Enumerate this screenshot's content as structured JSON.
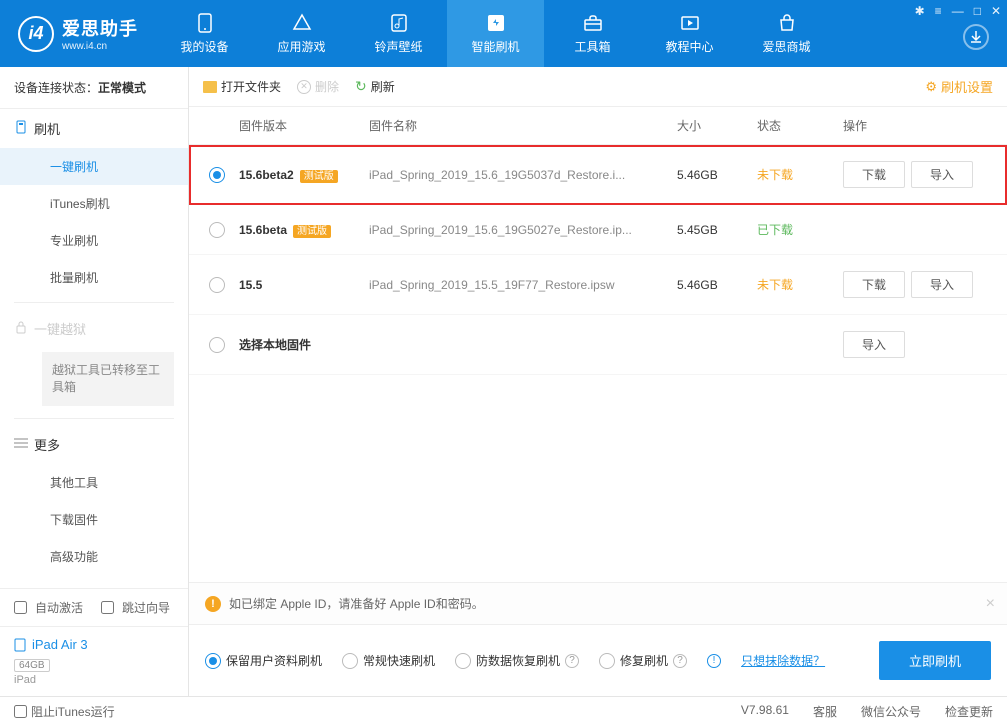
{
  "header": {
    "app_name": "爱思助手",
    "app_url": "www.i4.cn",
    "nav": [
      {
        "label": "我的设备",
        "icon": "device"
      },
      {
        "label": "应用游戏",
        "icon": "apps"
      },
      {
        "label": "铃声壁纸",
        "icon": "music"
      },
      {
        "label": "智能刷机",
        "icon": "flash"
      },
      {
        "label": "工具箱",
        "icon": "toolbox"
      },
      {
        "label": "教程中心",
        "icon": "tutorial"
      },
      {
        "label": "爱思商城",
        "icon": "store"
      }
    ]
  },
  "sidebar": {
    "conn_label": "设备连接状态：",
    "conn_value": "正常模式",
    "group_flash": "刷机",
    "items_flash": [
      "一键刷机",
      "iTunes刷机",
      "专业刷机",
      "批量刷机"
    ],
    "group_jail": "一键越狱",
    "jail_note": "越狱工具已转移至工具箱",
    "group_more": "更多",
    "items_more": [
      "其他工具",
      "下载固件",
      "高级功能"
    ],
    "auto_activate": "自动激活",
    "skip_guide": "跳过向导",
    "device_name": "iPad Air 3",
    "device_storage": "64GB",
    "device_type": "iPad"
  },
  "toolbar": {
    "open_folder": "打开文件夹",
    "delete": "删除",
    "refresh": "刷新",
    "settings": "刷机设置"
  },
  "table": {
    "head": {
      "ver": "固件版本",
      "name": "固件名称",
      "size": "大小",
      "status": "状态",
      "ops": "操作"
    },
    "rows": [
      {
        "ver": "15.6beta2",
        "beta": "测试版",
        "name": "iPad_Spring_2019_15.6_19G5037d_Restore.i...",
        "size": "5.46GB",
        "status": "未下载",
        "status_cls": "not",
        "selected": true,
        "show_ops": true,
        "highlighted": true
      },
      {
        "ver": "15.6beta",
        "beta": "测试版",
        "name": "iPad_Spring_2019_15.6_19G5027e_Restore.ip...",
        "size": "5.45GB",
        "status": "已下载",
        "status_cls": "done",
        "selected": false,
        "show_ops": false
      },
      {
        "ver": "15.5",
        "beta": "",
        "name": "iPad_Spring_2019_15.5_19F77_Restore.ipsw",
        "size": "5.46GB",
        "status": "未下载",
        "status_cls": "not",
        "selected": false,
        "show_ops": true
      },
      {
        "ver": "选择本地固件",
        "beta": "",
        "name": "",
        "size": "",
        "status": "",
        "selected": false,
        "show_ops": false,
        "import_only": true
      }
    ],
    "btn_download": "下载",
    "btn_import": "导入"
  },
  "bottom": {
    "notice": "如已绑定 Apple ID，请准备好 Apple ID和密码。",
    "opts": [
      "保留用户资料刷机",
      "常规快速刷机",
      "防数据恢复刷机",
      "修复刷机"
    ],
    "erase_link": "只想抹除数据？",
    "flash_btn": "立即刷机"
  },
  "statusbar": {
    "block_itunes": "阻止iTunes运行",
    "version": "V7.98.61",
    "links": [
      "客服",
      "微信公众号",
      "检查更新"
    ]
  }
}
